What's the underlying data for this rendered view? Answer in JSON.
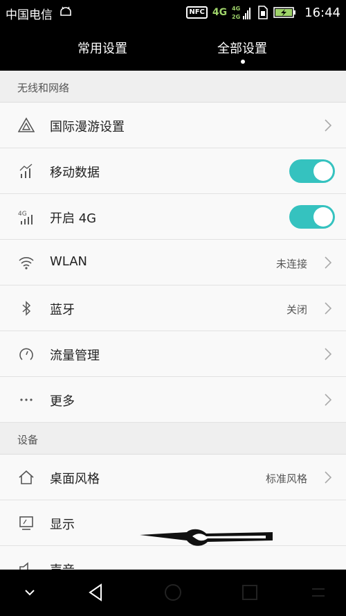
{
  "status_bar": {
    "carrier": "中国电信",
    "nfc": "NFC",
    "network": "4G",
    "time": "16:44"
  },
  "tabs": {
    "common": "常用设置",
    "all": "全部设置"
  },
  "sections": {
    "wireless": "无线和网络",
    "device": "设备"
  },
  "rows": {
    "roaming": {
      "label": "国际漫游设置"
    },
    "mobile_data": {
      "label": "移动数据",
      "on": true
    },
    "enable_4g": {
      "label": "开启 4G",
      "icon_text": "4G",
      "on": true
    },
    "wlan": {
      "label": "WLAN",
      "value": "未连接"
    },
    "bluetooth": {
      "label": "蓝牙",
      "value": "关闭"
    },
    "traffic": {
      "label": "流量管理"
    },
    "more": {
      "label": "更多"
    },
    "desktop_style": {
      "label": "桌面风格",
      "value": "标准风格"
    },
    "display": {
      "label": "显示"
    },
    "sound": {
      "label": "声音"
    }
  },
  "colors": {
    "toggle_on": "#35c2bf",
    "header_bg": "#000000"
  }
}
